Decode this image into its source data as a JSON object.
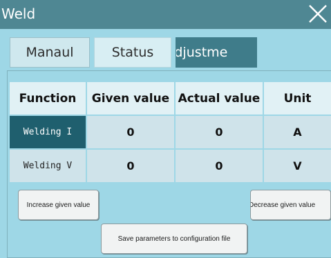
{
  "window": {
    "title": "Weld",
    "close_icon": "close-icon"
  },
  "tabs": [
    {
      "label": "Manaul"
    },
    {
      "label": "Status"
    },
    {
      "label": "ne adjustme"
    }
  ],
  "table": {
    "headers": [
      "Function",
      "Given value",
      "Actual value",
      "Unit"
    ],
    "rows": [
      {
        "function": "Welding I",
        "given": "0",
        "actual": "0",
        "unit": "A"
      },
      {
        "function": "Welding V",
        "given": "0",
        "actual": "0",
        "unit": "V"
      }
    ]
  },
  "buttons": {
    "increase": "Increase given value",
    "decrease": "Decrease given value",
    "save": "Save parameters to configuration file"
  },
  "colors": {
    "titlebar": "#4f8793",
    "background": "#9ed7e6",
    "selected_tab": "#3f7c8a",
    "selected_cell": "#1f5f6e"
  }
}
